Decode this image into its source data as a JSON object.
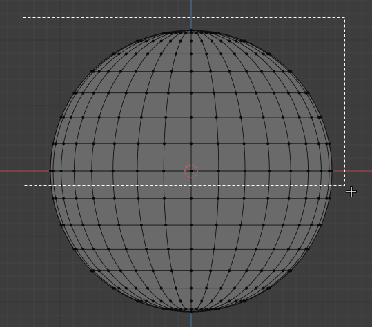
{
  "viewport": {
    "view": "top-orthographic",
    "mode": "edit-mode-vertex-select",
    "object": "uv-sphere",
    "tool": "box-select",
    "colors": {
      "background": "#3d3d3d",
      "grid_minor": "#454545",
      "grid_major": "#353535",
      "x_axis": "#b3474f",
      "y_axis": "#4c76a8",
      "mesh_fill": "#6a6a6a",
      "mesh_edge": "#121212",
      "vertex": "#0a0a0a",
      "selection_box": "#ffffff",
      "origin_ring": "#e05a5a"
    },
    "icons": {
      "origin": "3d-cursor-icon",
      "pointer": "crosshair-cursor-icon"
    }
  }
}
